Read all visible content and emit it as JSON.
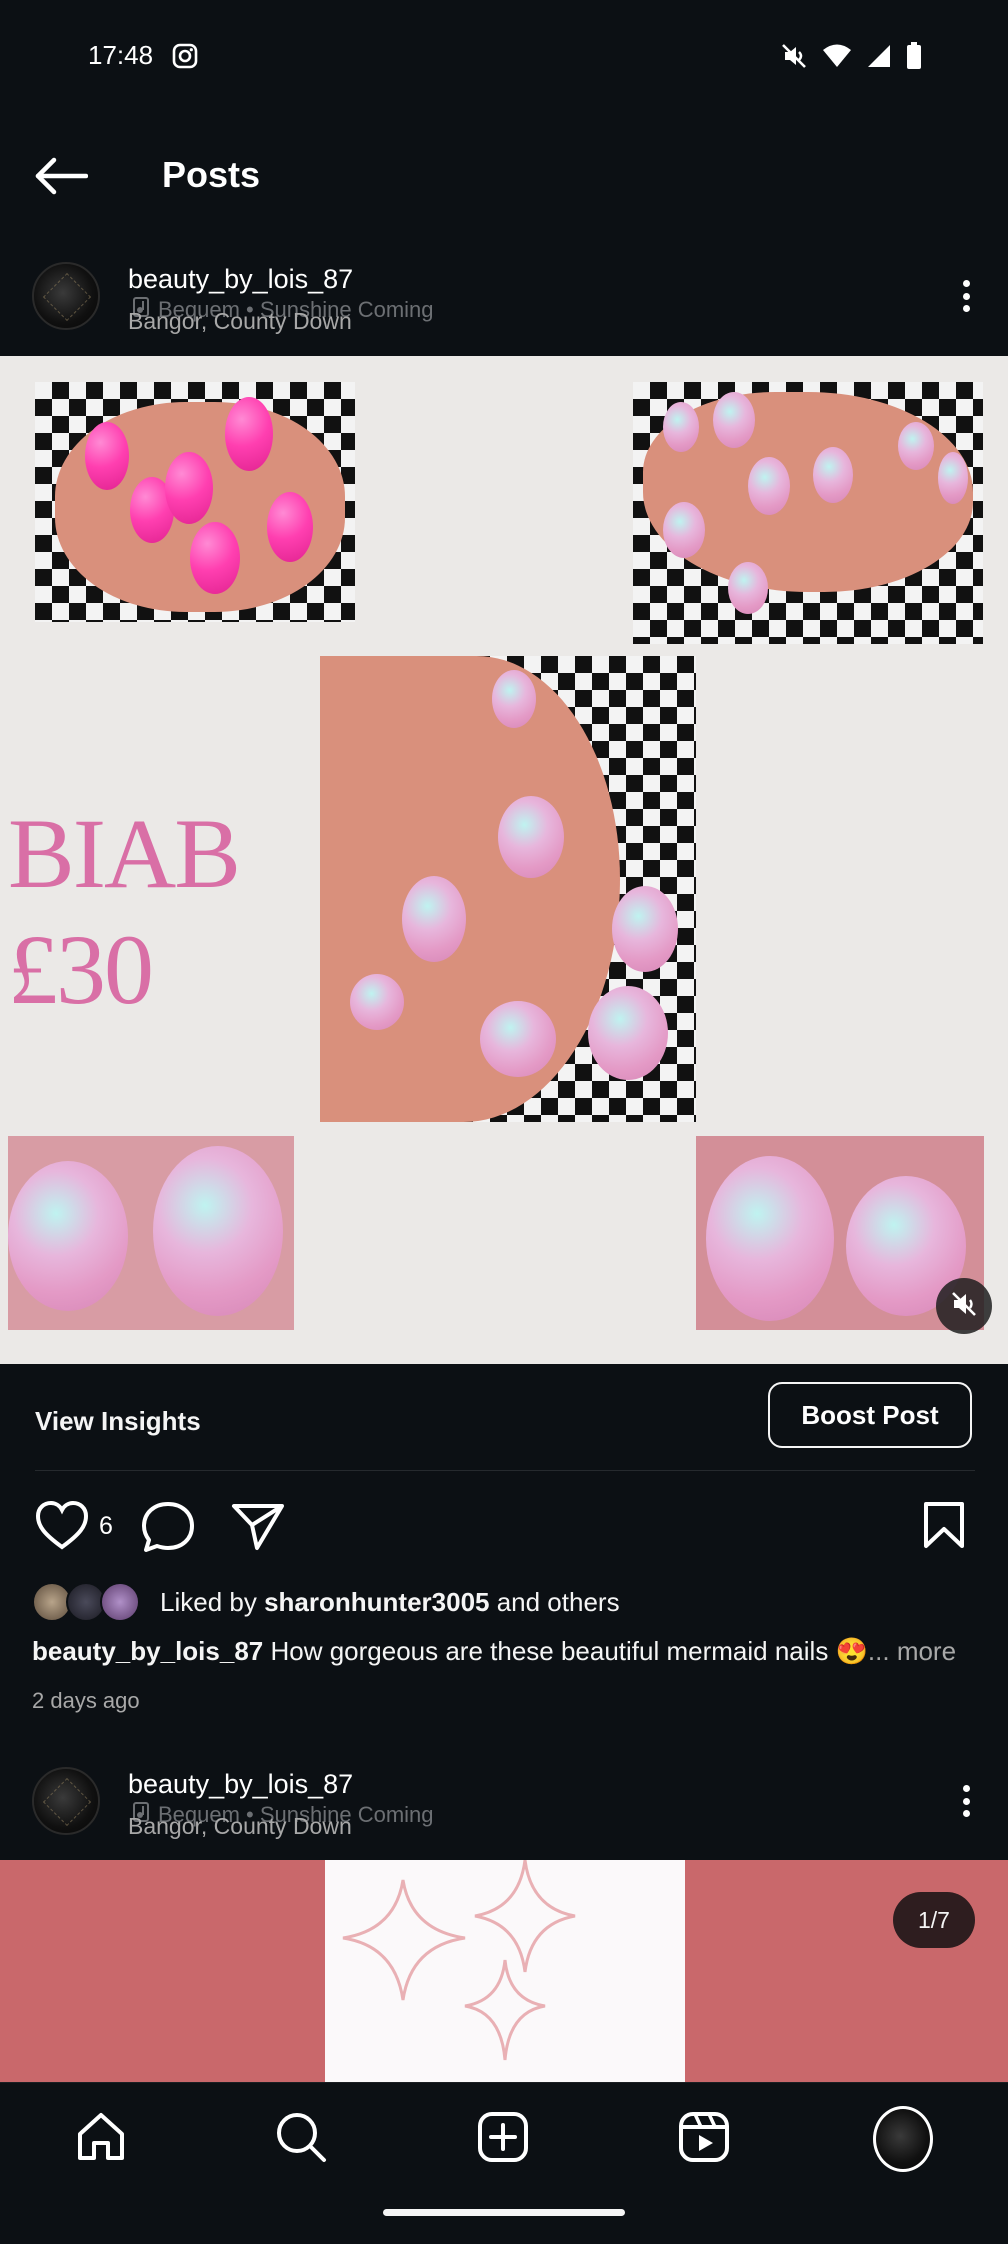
{
  "status_bar": {
    "time": "17:48"
  },
  "header": {
    "title": "Posts"
  },
  "post1": {
    "username": "beauty_by_lois_87",
    "music": "Bequem • Sunshine Coming",
    "location": "Bangor, County Down",
    "image_text_line1": "BIAB",
    "image_text_line2": "£30",
    "view_insights": "View Insights",
    "boost_post": "Boost Post",
    "like_count": "6",
    "liked_by_prefix": "Liked by ",
    "liked_by_user": "sharonhunter3005",
    "liked_by_suffix": " and others",
    "caption_user": "beauty_by_lois_87",
    "caption_text": " How gorgeous are these beautiful mermaid nails 😍",
    "caption_more": "... more",
    "timestamp": "2 days ago"
  },
  "post2": {
    "username": "beauty_by_lois_87",
    "music": "Bequem • Sunshine Coming",
    "location": "Bangor, County Down",
    "page_indicator": "1/7"
  },
  "icons": [
    "instagram-icon",
    "mute-icon",
    "wifi-icon",
    "signal-icon",
    "battery-icon",
    "back-arrow-icon",
    "more-icon",
    "muted-audio-icon",
    "heart-icon",
    "comment-icon",
    "share-icon",
    "bookmark-icon",
    "home-icon",
    "search-icon",
    "create-icon",
    "reels-icon",
    "music-icon"
  ],
  "colors": {
    "background": "#0c1014",
    "biab_text": "#d96fa6",
    "media2_background": "#c9686b"
  }
}
